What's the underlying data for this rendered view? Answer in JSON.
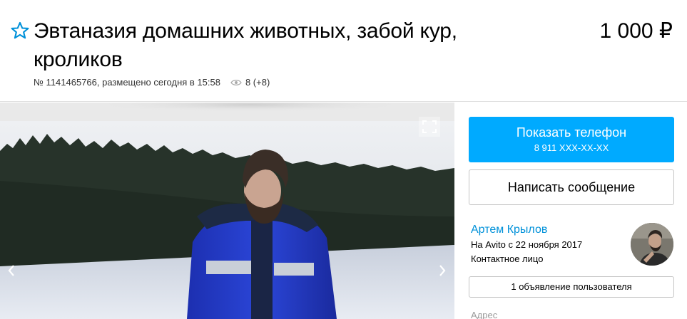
{
  "listing": {
    "title": "Эвтаназия домашних животных, забой кур, кроликов",
    "price": "1 000 ₽",
    "meta": "№ 1141465766, размещено сегодня в 15:58",
    "views": "8 (+8)"
  },
  "icons": {
    "favorite": "star-outline-icon",
    "views": "eye-icon",
    "fullscreen": "fullscreen-icon",
    "prev": "chevron-left-icon",
    "next": "chevron-right-icon"
  },
  "actions": {
    "show_phone_label": "Показать телефон",
    "phone_masked": "8 911 XXX-XX-XX",
    "write_message_label": "Написать сообщение"
  },
  "seller": {
    "name": "Артем Крылов",
    "since": "На Avito с 22 ноября 2017",
    "type": "Контактное лицо",
    "ads_count_label": "1 объявление пользователя"
  },
  "address": {
    "label": "Адрес"
  },
  "colors": {
    "accent": "#00aaff",
    "link": "#0091d9",
    "star": "#0091d9"
  }
}
